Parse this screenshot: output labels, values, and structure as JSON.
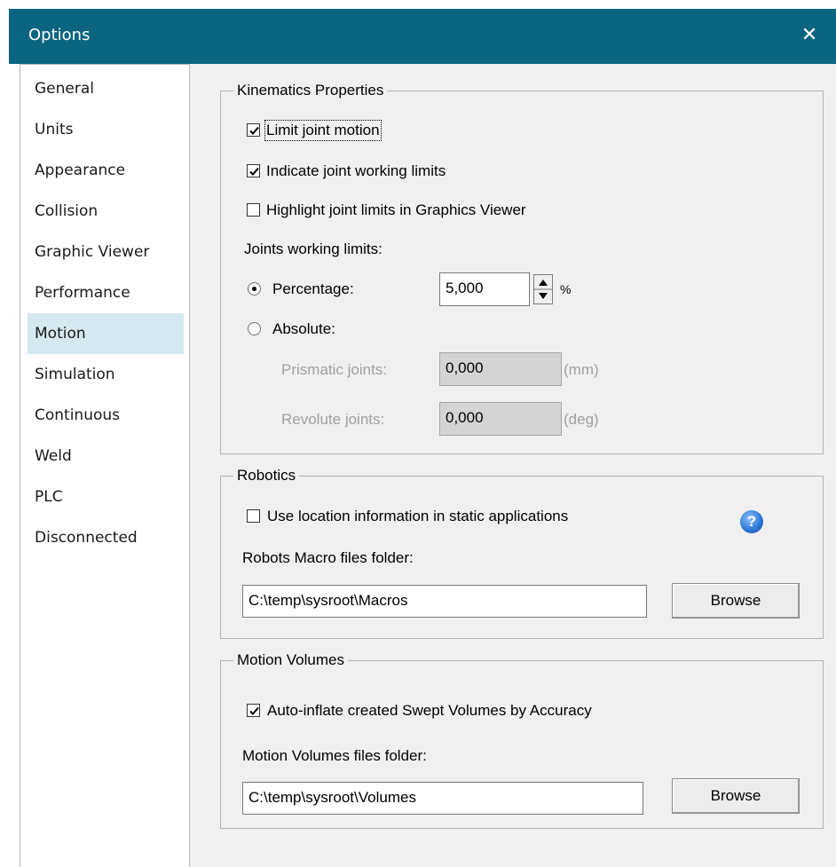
{
  "window": {
    "title": "Options",
    "close_glyph": "✕"
  },
  "nav": {
    "items": [
      {
        "label": "General"
      },
      {
        "label": "Units"
      },
      {
        "label": "Appearance"
      },
      {
        "label": "Collision"
      },
      {
        "label": "Graphic Viewer"
      },
      {
        "label": "Performance"
      },
      {
        "label": "Motion",
        "selected": true
      },
      {
        "label": "Simulation"
      },
      {
        "label": "Continuous"
      },
      {
        "label": "Weld"
      },
      {
        "label": "PLC"
      },
      {
        "label": "Disconnected"
      }
    ]
  },
  "kinematics": {
    "title": "Kinematics Properties",
    "limit_joint_motion": {
      "label": "Limit joint motion",
      "checked": true
    },
    "indicate_limits": {
      "label": "Indicate joint working limits",
      "checked": true
    },
    "highlight_limits": {
      "label": "Highlight joint limits in Graphics Viewer",
      "checked": false
    },
    "working_limits_label": "Joints working limits:",
    "percentage": {
      "label": "Percentage:",
      "selected": true,
      "value": "5,000",
      "unit": "%"
    },
    "absolute": {
      "label": "Absolute:",
      "selected": false
    },
    "prismatic": {
      "label": "Prismatic joints:",
      "value": "0,000",
      "unit": "(mm)"
    },
    "revolute": {
      "label": "Revolute joints:",
      "value": "0,000",
      "unit": "(deg)"
    }
  },
  "robotics": {
    "title": "Robotics",
    "use_location": {
      "label": "Use location information in static applications",
      "checked": false
    },
    "help_glyph": "?",
    "macro_folder_label": "Robots Macro files folder:",
    "macro_folder_value": "C:\\temp\\sysroot\\Macros",
    "browse_label": "Browse"
  },
  "motion_volumes": {
    "title": "Motion Volumes",
    "auto_inflate": {
      "label": "Auto-inflate created Swept Volumes by Accuracy",
      "checked": true
    },
    "folder_label": "Motion Volumes files folder:",
    "folder_value": "C:\\temp\\sysroot\\Volumes",
    "browse_label": "Browse"
  },
  "colors": {
    "titlebar": "#0b6580",
    "selected_nav": "#d5e7ef",
    "panel_bg": "#f0f0f0"
  }
}
